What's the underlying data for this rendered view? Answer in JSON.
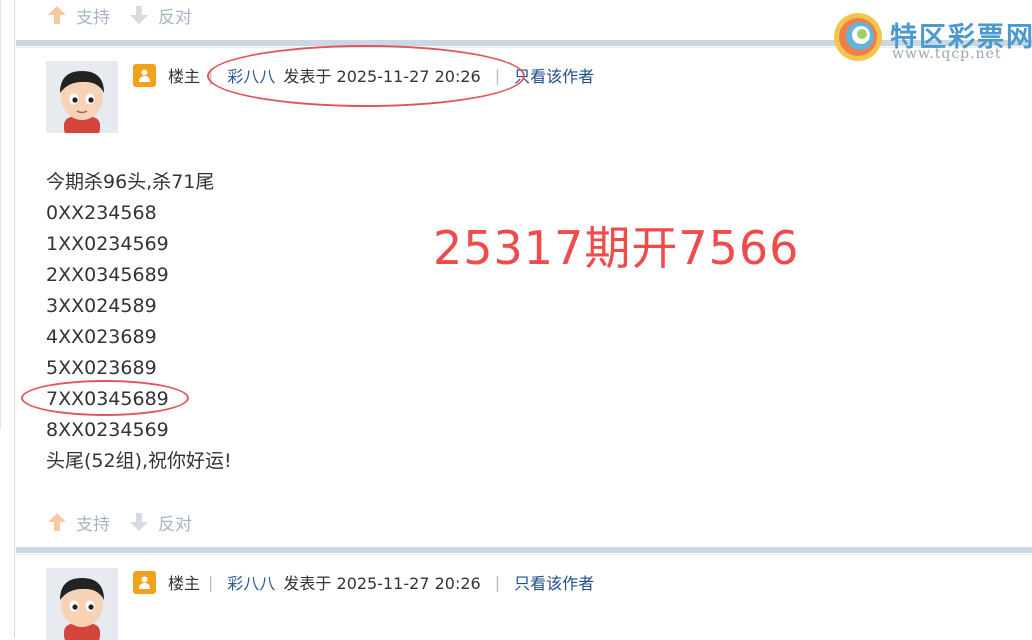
{
  "vote_bar_top": {
    "support_label": "支持",
    "oppose_label": "反对"
  },
  "posts": [
    {
      "role": "楼主",
      "author": "彩八八",
      "posted_at": "发表于 2025-11-27 20:26",
      "only_author_link": "只看该作者",
      "lines": [
        "今期杀96头,杀71尾",
        "0XX234568",
        "1XX0234569",
        "2XX0345689",
        "3XX024589",
        "4XX023689",
        "5XX023689",
        "7XX0345689",
        "8XX0234569",
        "头尾(52组),祝你好运!"
      ],
      "annotation": "25317期开7566",
      "support_label": "支持",
      "oppose_label": "反对"
    },
    {
      "role": "楼主",
      "author": "彩八八",
      "posted_at": "发表于 2025-11-27 20:26",
      "only_author_link": "只看该作者"
    }
  ],
  "watermark": {
    "name": "特区彩票网",
    "url": "www.tqcp.net"
  },
  "colors": {
    "annotation_red": "#f04b4b",
    "link_blue": "#1f4f8a",
    "separator": "#c9d8e3",
    "vote_gray": "#a6b4c4"
  }
}
